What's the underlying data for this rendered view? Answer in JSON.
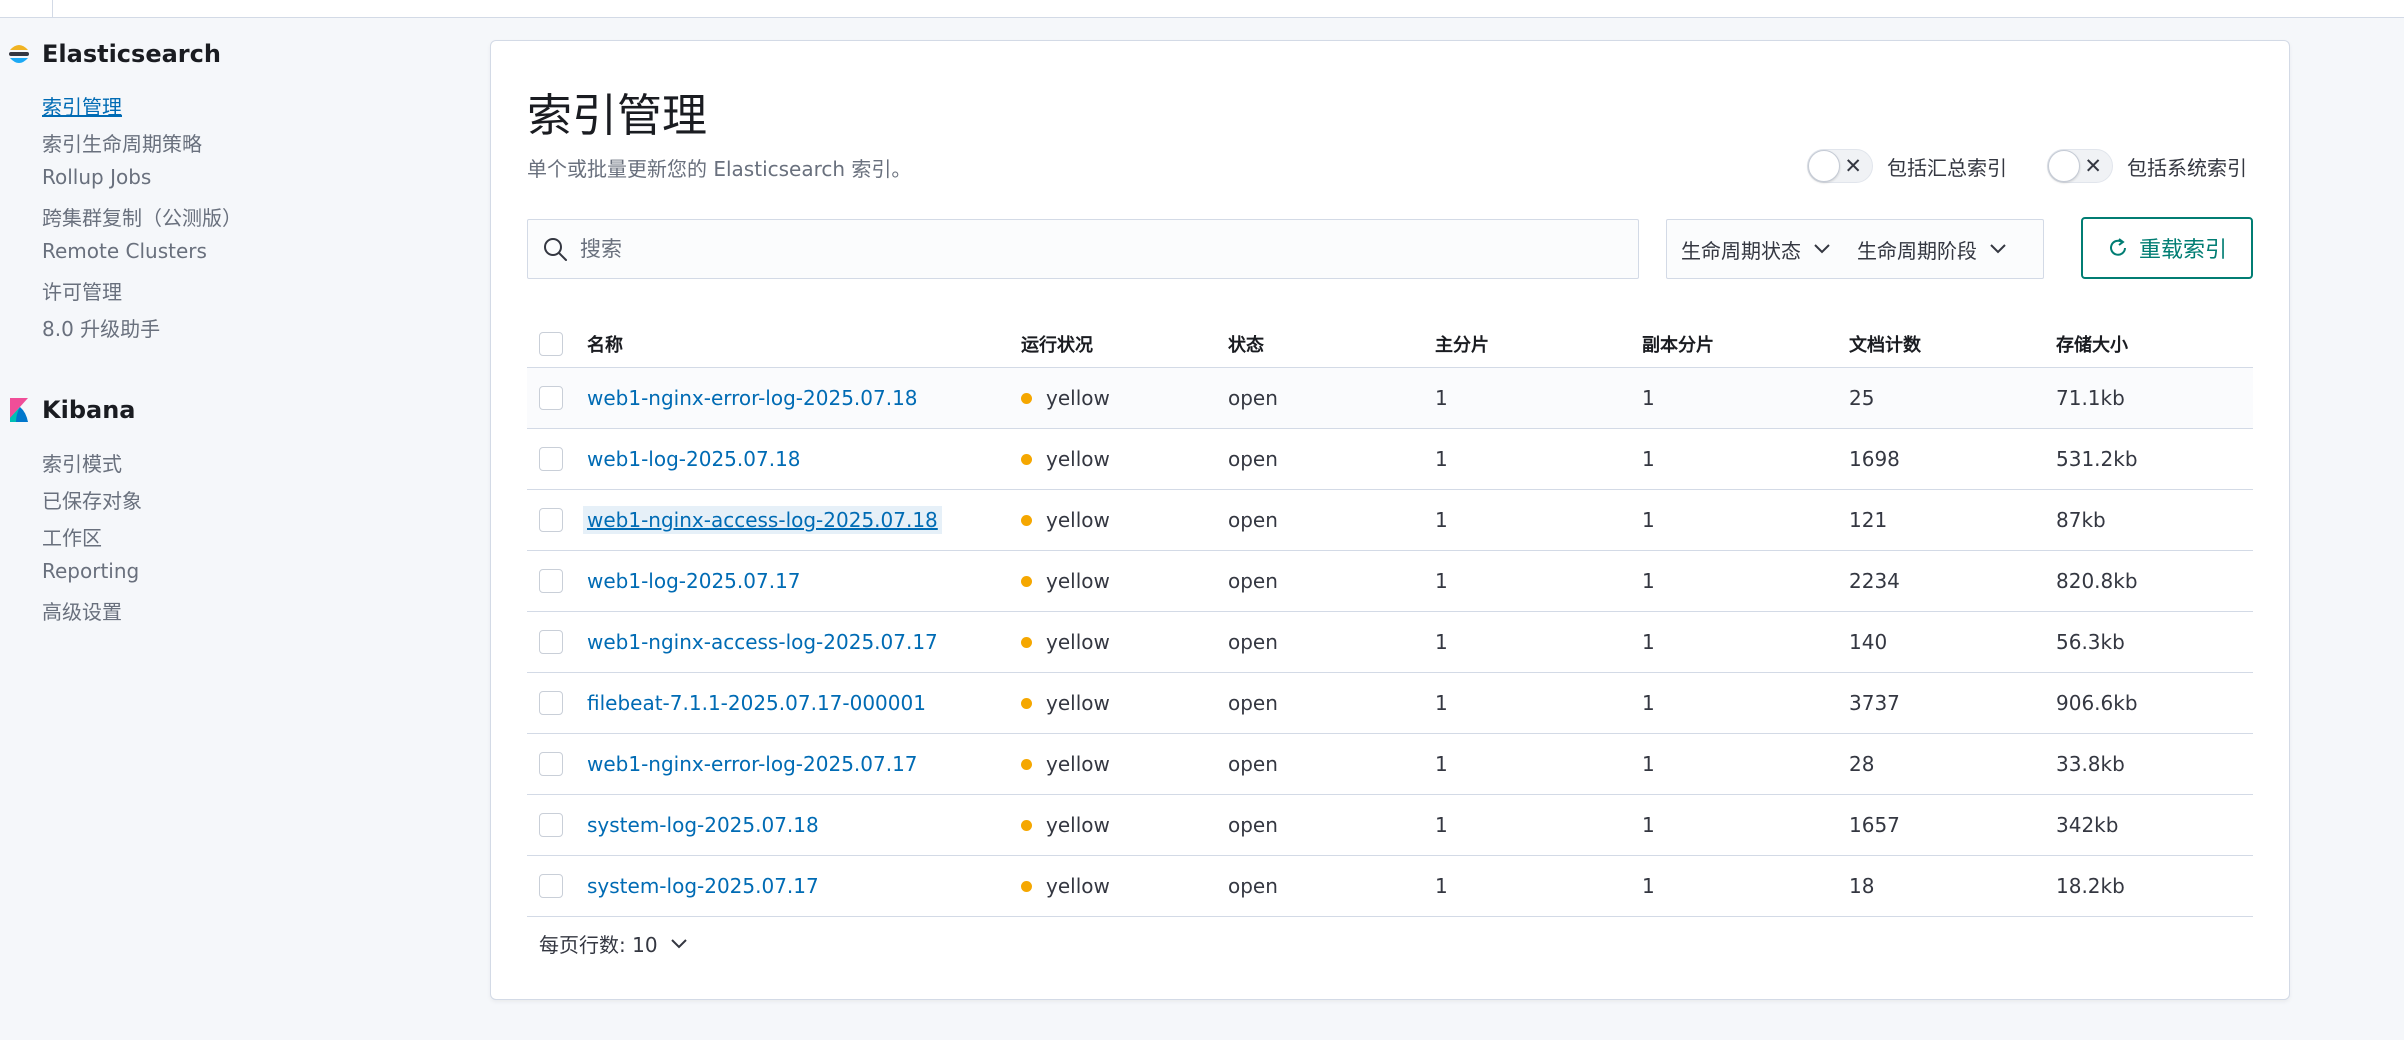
{
  "sidebar": {
    "groups": [
      {
        "title": "Elasticsearch",
        "items": [
          {
            "label": "索引管理"
          },
          {
            "label": "索引生命周期策略"
          },
          {
            "label": "Rollup Jobs"
          },
          {
            "label": "跨集群复制（公测版）"
          },
          {
            "label": "Remote Clusters"
          },
          {
            "label": "许可管理"
          },
          {
            "label": "8.0 升级助手"
          }
        ]
      },
      {
        "title": "Kibana",
        "items": [
          {
            "label": "索引模式"
          },
          {
            "label": "已保存对象"
          },
          {
            "label": "工作区"
          },
          {
            "label": "Reporting"
          },
          {
            "label": "高级设置"
          }
        ]
      }
    ]
  },
  "main": {
    "title": "索引管理",
    "description": "单个或批量更新您的 Elasticsearch 索引。",
    "toggles": {
      "rollup_label": "包括汇总索引",
      "system_label": "包括系统索引"
    },
    "search": {
      "placeholder": "搜索"
    },
    "filters": {
      "lifecycle_status": "生命周期状态",
      "lifecycle_phase": "生命周期阶段"
    },
    "reload_label": "重载索引",
    "table": {
      "columns": [
        "名称",
        "运行状况",
        "状态",
        "主分片",
        "副本分片",
        "文档计数",
        "存储大小"
      ],
      "rows": [
        {
          "name": "web1-nginx-error-log-2025.07.18",
          "health": "yellow",
          "status": "open",
          "primary": "1",
          "replicas": "1",
          "docs": "25",
          "size": "71.1kb"
        },
        {
          "name": "web1-log-2025.07.18",
          "health": "yellow",
          "status": "open",
          "primary": "1",
          "replicas": "1",
          "docs": "1698",
          "size": "531.2kb"
        },
        {
          "name": "web1-nginx-access-log-2025.07.18",
          "health": "yellow",
          "status": "open",
          "primary": "1",
          "replicas": "1",
          "docs": "121",
          "size": "87kb"
        },
        {
          "name": "web1-log-2025.07.17",
          "health": "yellow",
          "status": "open",
          "primary": "1",
          "replicas": "1",
          "docs": "2234",
          "size": "820.8kb"
        },
        {
          "name": "web1-nginx-access-log-2025.07.17",
          "health": "yellow",
          "status": "open",
          "primary": "1",
          "replicas": "1",
          "docs": "140",
          "size": "56.3kb"
        },
        {
          "name": "filebeat-7.1.1-2025.07.17-000001",
          "health": "yellow",
          "status": "open",
          "primary": "1",
          "replicas": "1",
          "docs": "3737",
          "size": "906.6kb"
        },
        {
          "name": "web1-nginx-error-log-2025.07.17",
          "health": "yellow",
          "status": "open",
          "primary": "1",
          "replicas": "1",
          "docs": "28",
          "size": "33.8kb"
        },
        {
          "name": "system-log-2025.07.18",
          "health": "yellow",
          "status": "open",
          "primary": "1",
          "replicas": "1",
          "docs": "1657",
          "size": "342kb"
        },
        {
          "name": "system-log-2025.07.17",
          "health": "yellow",
          "status": "open",
          "primary": "1",
          "replicas": "1",
          "docs": "18",
          "size": "18.2kb"
        }
      ]
    },
    "pagination": {
      "rows_per_page": "每页行数: 10"
    }
  },
  "colors": {
    "link": "#006bb4",
    "health_yellow": "#f5a700",
    "reload_accent": "#017d73"
  }
}
